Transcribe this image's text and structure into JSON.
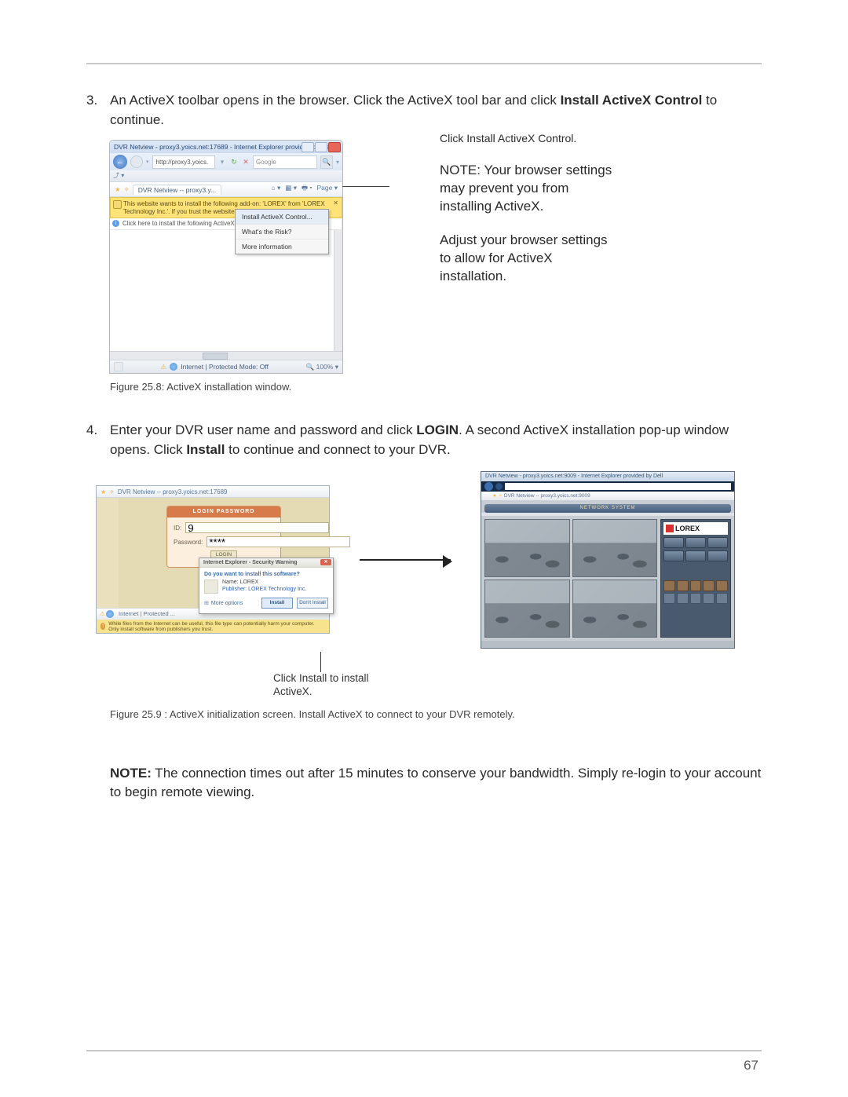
{
  "page_number": "67",
  "step3": {
    "num": "3.",
    "text_a": "An ActiveX toolbar opens in the browser. Click the ActiveX tool bar and click ",
    "bold_a": "Install ActiveX Control",
    "text_b": " to continue."
  },
  "ie1": {
    "title": "DVR Netview - proxy3.yoics.net:17689 - Internet Explorer provided by Dell",
    "url": "http://proxy3.yoics.",
    "search_ph": "Google",
    "favtab": "DVR Netview -- proxy3.y...",
    "fav_right_page": "Page",
    "ax_line1": "This website wants to install the following add-on: 'LOREX' from 'LOREX Technology Inc.'. If you trust the website and the add-on and wa...",
    "click_msg": "Click here to install the following ActiveX control: 'LO...",
    "ctx": {
      "install": "Install ActiveX Control...",
      "risk": "What's the Risk?",
      "more": "More information"
    },
    "status": "Internet | Protected Mode: Off",
    "zoom": "100%"
  },
  "annot1": {
    "callout": "Click Install ActiveX Control.",
    "p1": "NOTE: Your browser settings may prevent you from installing ActiveX.",
    "p2": "Adjust your browser settings to allow for ActiveX installation."
  },
  "caption1": "Figure 25.8: ActiveX installation window.",
  "step4": {
    "num": "4.",
    "text_a": "Enter your DVR user name and password and click ",
    "bold_a": "LOGIN",
    "text_b": ". A second ActiveX installation pop-up window opens. Click ",
    "bold_b": "Install",
    "text_c": " to continue and connect to your DVR."
  },
  "login": {
    "tab": "DVR Netview -- proxy3.yoics.net:17689",
    "head": "LOGIN PASSWORD",
    "id_label": "ID:",
    "id_value": "9",
    "pw_label": "Password:",
    "pw_value": "****",
    "btn": "LOGIN",
    "status": "Internet | Protected ...",
    "warn": "While files from the Internet can be useful, this file type can potentially harm your computer. Only install software from publishers you trust."
  },
  "secdlg": {
    "title": "Internet Explorer - Security Warning",
    "q": "Do you want to install this software?",
    "name": "Name: LOREX",
    "pub": "Publisher: LOREX Technology Inc.",
    "more": "More options",
    "install": "Install",
    "dont": "Don't Install"
  },
  "netview": {
    "title": "DVR Netview - proxy3.yoics.net:9009 - Internet Explorer provided by Dell",
    "tab": "DVR Netview -- proxy3.yoics.net:9009",
    "strip": "NETWORK SYSTEM",
    "logo": "LOREX"
  },
  "callout2": "Click Install to install ActiveX.",
  "caption2": "Figure 25.9 : ActiveX initialization screen. Install ActiveX to connect to your DVR remotely.",
  "note": {
    "label": "NOTE:",
    "text": " The connection times out after 15 minutes to conserve your bandwidth. Simply re-login to your account to begin remote viewing."
  }
}
